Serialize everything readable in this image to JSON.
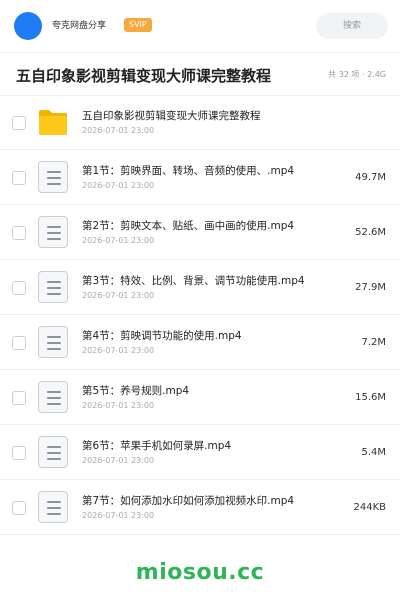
{
  "header": {
    "app_name": "夸克网盘分享",
    "badge": "SVIP",
    "search_label": "搜索",
    "accent": "#1f7cf5",
    "badge_color": "#f7a93b"
  },
  "folder": {
    "title": "五自印象影视剪辑变现大师课完整教程",
    "summary": "共 32 项 · 2.4G"
  },
  "files": [
    {
      "icon": "folder-icon",
      "name": "五自印象影视剪辑变现大师课完整教程",
      "date": "2026-07-01 23:00",
      "size": ""
    },
    {
      "icon": "video-file-icon",
      "name": "第1节：剪映界面、转场、音频的使用、.mp4",
      "date": "2026-07-01 23:00",
      "size": "49.7M"
    },
    {
      "icon": "video-file-icon",
      "name": "第2节：剪映文本、贴纸、画中画的使用.mp4",
      "date": "2026-07-01 23:00",
      "size": "52.6M"
    },
    {
      "icon": "video-file-icon",
      "name": "第3节：特效、比例、背景、调节功能使用.mp4",
      "date": "2026-07-01 23:00",
      "size": "27.9M"
    },
    {
      "icon": "video-file-icon",
      "name": "第4节：剪映调节功能的使用.mp4",
      "date": "2026-07-01 23:00",
      "size": "7.2M"
    },
    {
      "icon": "video-file-icon",
      "name": "第5节：养号规则.mp4",
      "date": "2026-07-01 23:00",
      "size": "15.6M"
    },
    {
      "icon": "video-file-icon",
      "name": "第6节：苹果手机如何录屏.mp4",
      "date": "2026-07-01 23:00",
      "size": "5.4M"
    },
    {
      "icon": "video-file-icon",
      "name": "第7节：如何添加水印如何添加视频水印.mp4",
      "date": "2026-07-01 23:00",
      "size": "244KB"
    }
  ],
  "watermark": "miosou.cc",
  "watermark_color": "#2fb457"
}
